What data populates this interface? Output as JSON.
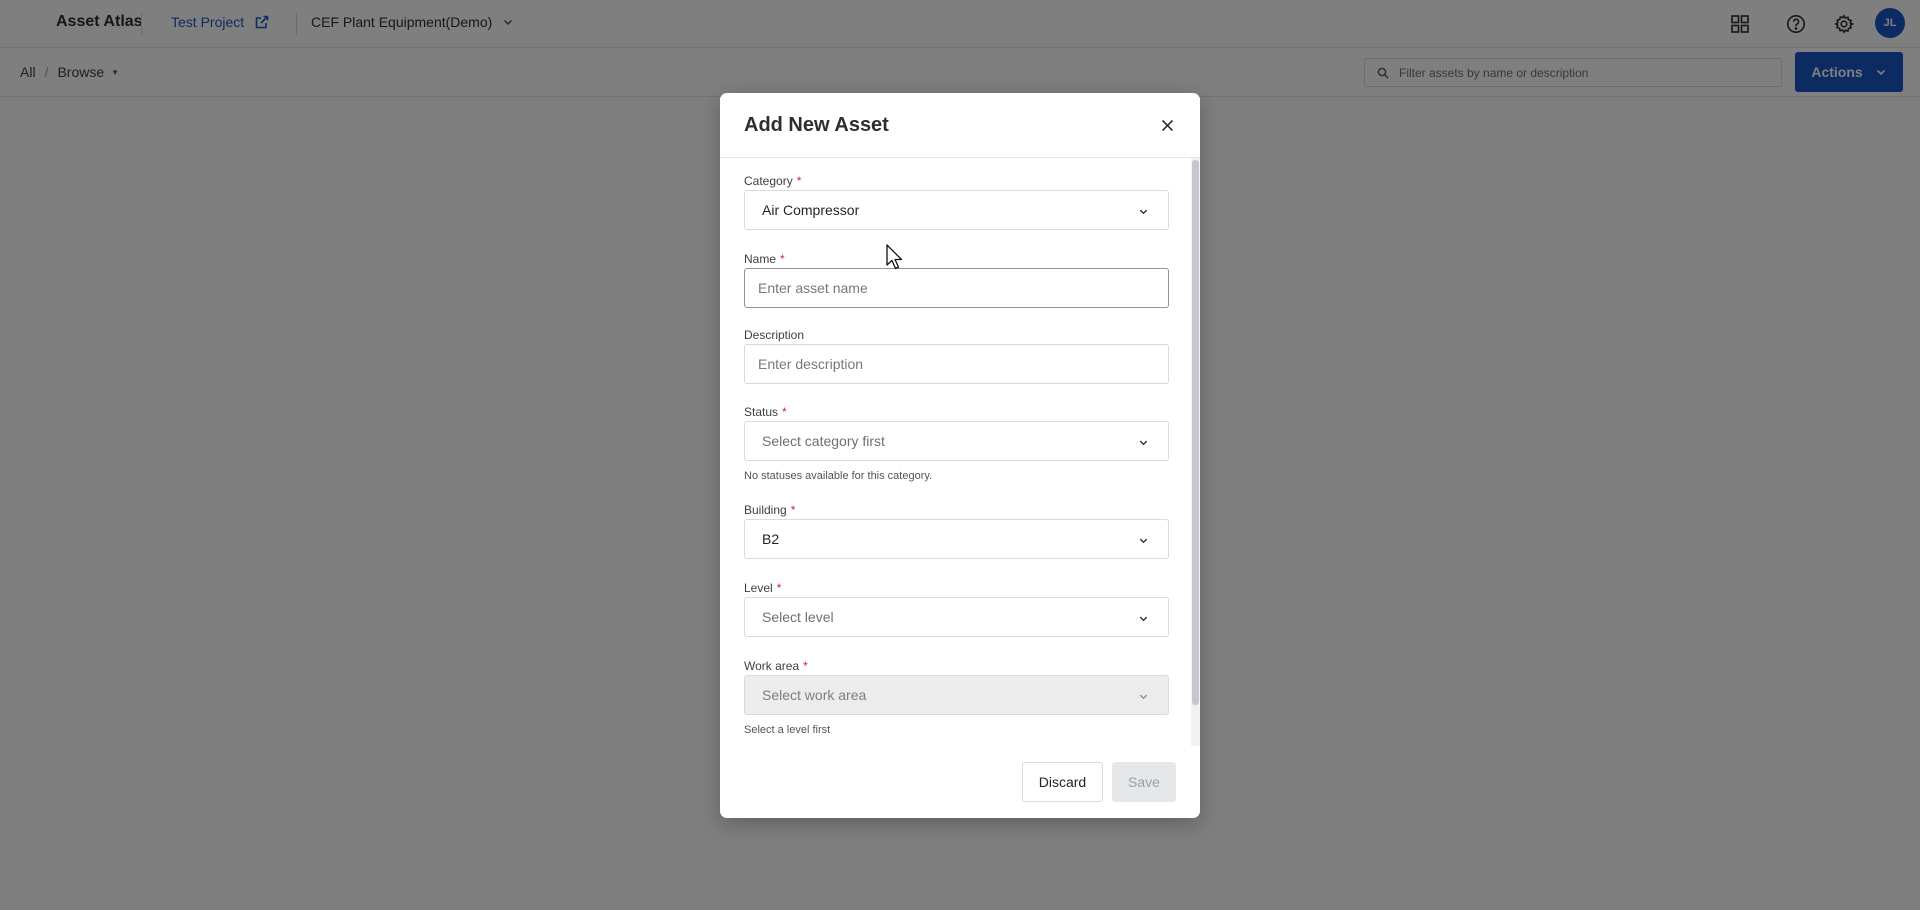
{
  "app": {
    "brand": "Asset Atlas",
    "project": "Test Project",
    "dataset": "CEF Plant Equipment(Demo)",
    "avatar_initials": "JL",
    "accent_color": "#1a56c7"
  },
  "breadcrumb": {
    "all": "All",
    "browse": "Browse"
  },
  "filter": {
    "placeholder": "Filter assets by name or description"
  },
  "actions_label": "Actions",
  "modal": {
    "title": "Add New Asset",
    "category": {
      "label": "Category",
      "value": "Air Compressor"
    },
    "name": {
      "label": "Name",
      "placeholder": "Enter asset name"
    },
    "description": {
      "label": "Description",
      "placeholder": "Enter description"
    },
    "status": {
      "label": "Status",
      "placeholder": "Select category first",
      "help": "No statuses available for this category."
    },
    "building": {
      "label": "Building",
      "value": "B2"
    },
    "level": {
      "label": "Level",
      "placeholder": "Select level"
    },
    "work_area": {
      "label": "Work area",
      "placeholder": "Select work area",
      "help": "Select a level first"
    },
    "required_mark": "*",
    "discard_label": "Discard",
    "save_label": "Save"
  },
  "icons": [
    "external-link-icon",
    "chevron-down-icon",
    "grid-icon",
    "help-icon",
    "gear-icon",
    "search-icon",
    "close-icon",
    "cursor-icon"
  ]
}
